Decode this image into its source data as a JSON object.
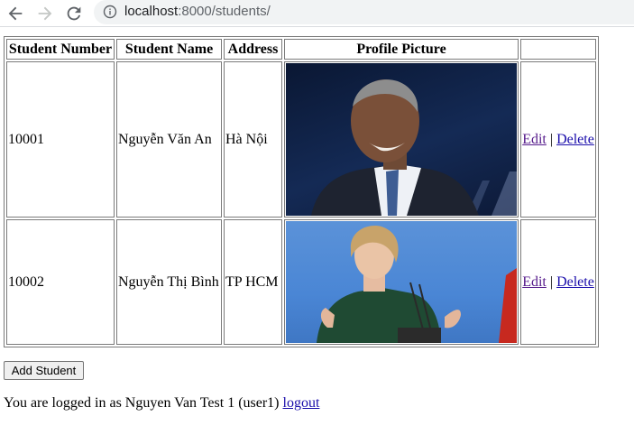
{
  "browser": {
    "url_host": "localhost",
    "url_path": ":8000/students/"
  },
  "table": {
    "headers": [
      "Student Number",
      "Student Name",
      "Address",
      "Profile Picture",
      ""
    ],
    "rows": [
      {
        "number": "10001",
        "name": "Nguyễn Văn An",
        "address": "Hà Nội",
        "edit": "Edit",
        "separator": "|",
        "delete": "Delete"
      },
      {
        "number": "10002",
        "name": "Nguyễn Thị Bình",
        "address": "TP HCM",
        "edit": "Edit",
        "separator": "|",
        "delete": "Delete"
      }
    ]
  },
  "add_button": "Add Student",
  "footer": {
    "logged_in_text": "You are logged in as Nguyen Van Test 1 (user1)",
    "logout": "logout"
  },
  "colors": {
    "link": "#1a0dab",
    "visited_link": "#551a8b"
  }
}
